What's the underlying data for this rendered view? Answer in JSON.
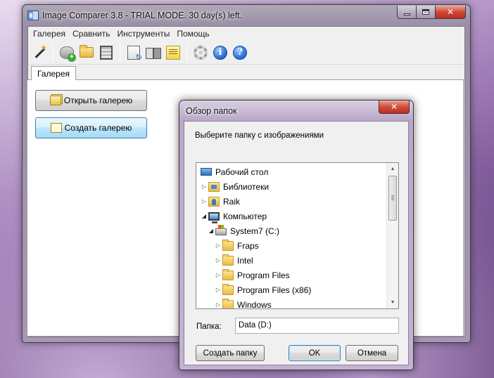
{
  "window": {
    "title": "Image Comparer 3.8 - TRIAL MODE. 30 day(s) left.",
    "close_glyph": "✕"
  },
  "menu": [
    "Галерея",
    "Сравнить",
    "Инструменты",
    "Помощь"
  ],
  "toolbar": {
    "icons": [
      "magic-wand-icon",
      "add-disk-icon",
      "open-folder-icon",
      "filmstrip-icon",
      "refresh-document-icon",
      "compare-icon",
      "notes-icon",
      "settings-gear-icon",
      "info-icon",
      "help-icon"
    ],
    "info_glyph": "i",
    "help_glyph": "?"
  },
  "tabs": {
    "active": "Галерея"
  },
  "gallery": {
    "open_label": "Открыть галерею",
    "create_label": "Создать галерею"
  },
  "dialog": {
    "title": "Обзор папок",
    "close_glyph": "✕",
    "prompt": "Выберите папку с изображениями",
    "tree": [
      {
        "label": "Рабочий стол",
        "icon": "desktop",
        "level": 0,
        "expander": ""
      },
      {
        "label": "Библиотеки",
        "icon": "libs",
        "level": 1,
        "expander": "▷"
      },
      {
        "label": "Raik",
        "icon": "user",
        "level": 1,
        "expander": "▷"
      },
      {
        "label": "Компьютер",
        "icon": "computer",
        "level": 1,
        "expander": "◢"
      },
      {
        "label": "System7 (C:)",
        "icon": "drive",
        "level": 2,
        "expander": "◢"
      },
      {
        "label": "Fraps",
        "icon": "folder",
        "level": 3,
        "expander": "▷"
      },
      {
        "label": "Intel",
        "icon": "folder",
        "level": 3,
        "expander": "▷"
      },
      {
        "label": "Program Files",
        "icon": "folder",
        "level": 3,
        "expander": "▷"
      },
      {
        "label": "Program Files (x86)",
        "icon": "folder",
        "level": 3,
        "expander": "▷"
      },
      {
        "label": "Windows",
        "icon": "folder",
        "level": 3,
        "expander": "▷"
      }
    ],
    "scroll_up": "▲",
    "scroll_down": "▼",
    "folder_label": "Папка:",
    "folder_value": "Data (D:)",
    "buttons": {
      "new_folder": "Создать папку",
      "ok": "OK",
      "cancel": "Отмена"
    }
  }
}
